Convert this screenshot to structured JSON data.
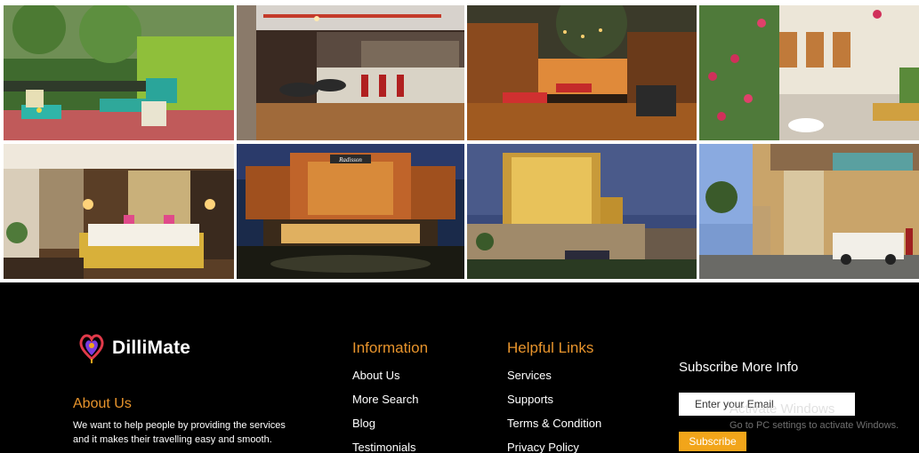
{
  "gallery": {
    "photos": [
      {
        "name": "garden-terrace-cafe",
        "accent": "#4f8f3a"
      },
      {
        "name": "industrial-bar-interior",
        "accent": "#7a4a2a"
      },
      {
        "name": "night-courtyard-restaurant",
        "accent": "#b5601c"
      },
      {
        "name": "rose-garden-patio",
        "accent": "#c0407a"
      },
      {
        "name": "hotel-bedroom",
        "accent": "#c9a05a"
      },
      {
        "name": "radisson-hotel-night",
        "accent": "#d07a2a"
      },
      {
        "name": "tower-hotel-dusk",
        "accent": "#e0b44a"
      },
      {
        "name": "elephant-pillar-entrance",
        "accent": "#b89a6a"
      }
    ],
    "hotel_sign": "Radisson"
  },
  "footer": {
    "brand": {
      "name": "DilliMate",
      "logo_icon": "heart-pin-icon"
    },
    "about": {
      "title": "About Us",
      "text": "We want to help people by providing the services and it makes their travelling easy and smooth."
    },
    "information": {
      "title": "Information",
      "links": [
        "About Us",
        "More Search",
        "Blog",
        "Testimonials"
      ]
    },
    "helpful_links": {
      "title": "Helpful Links",
      "links": [
        "Services",
        "Supports",
        "Terms & Condition",
        "Privacy Policy"
      ]
    },
    "subscribe": {
      "title": "Subscribe More Info",
      "email_placeholder": "Enter your Email",
      "button_label": "Subscribe"
    },
    "watermark": {
      "title": "Activate Windows",
      "subtitle": "Go to PC settings to activate Windows."
    }
  },
  "colors": {
    "footer_bg": "#000000",
    "accent_orange": "#e8942c",
    "button_orange": "#f2a51a"
  }
}
